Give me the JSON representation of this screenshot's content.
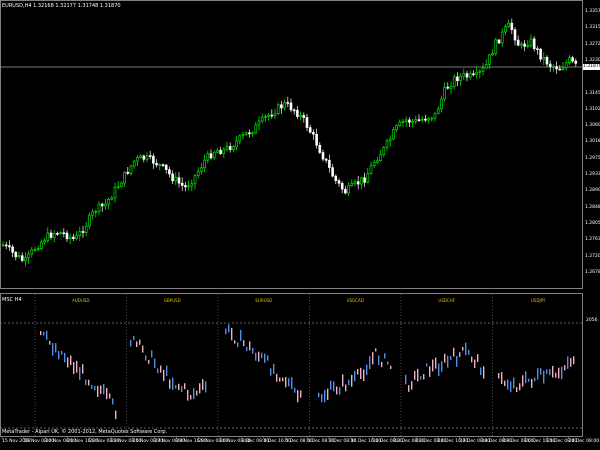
{
  "main": {
    "symbol_header": "EURUSD,H4  1.32168 1.32177 1.31748 1.31870",
    "current_price": "1.31870",
    "price_labels": [
      "1.33575",
      "1.33150",
      "1.32725",
      "1.32300",
      "1.31870",
      "1.31450",
      "1.31025",
      "1.30600",
      "1.30180",
      "1.29755",
      "1.29330",
      "1.28905",
      "1.28480",
      "1.28055",
      "1.27630",
      "1.27205",
      "1.26785"
    ],
    "colors": {
      "bull": "#00ff00",
      "bear": "#ffffff",
      "background": "#000000",
      "grid": "#808080"
    }
  },
  "sub": {
    "title": "MSC H4",
    "level_label": "2056",
    "pairs": [
      "AUDUSD",
      "GBPUSD",
      "EURUSD",
      "USDCAD",
      "USDCHF",
      "USDJPY"
    ],
    "pair_color": "#e0c000",
    "bar_colors": [
      "#4f8fe8",
      "#f0b0c0"
    ],
    "copyright": "MetaTrader - Alpari UK, © 2001-2012, MetaQuotes Software Corp."
  },
  "time_axis": [
    "15 Nov 2012",
    "19 Nov 08:00",
    "20 Nov 08:00",
    "21 Nov 16:00",
    "22 Nov 08:00",
    "23 Nov 08:00",
    "26 Nov 08:00",
    "27 Nov 08:00",
    "28 Nov 16:00",
    "29 Nov 08:00",
    "30 Nov 08:00",
    "3 Dec 08:00",
    "4 Dec 16:00",
    "5 Dec 08:00",
    "6 Dec 08:00",
    "7 Dec 08:00",
    "10 Dec 16:00",
    "11 Dec 08:00",
    "12 Dec 08:00",
    "13 Dec 08:00",
    "14 Dec 16:00",
    "17 Dec 08:00",
    "18 Dec 08:00",
    "19 Dec 08:00",
    "20 Dec 16:00",
    "21 Dec 08:00",
    "24 Dec 08:00"
  ]
}
